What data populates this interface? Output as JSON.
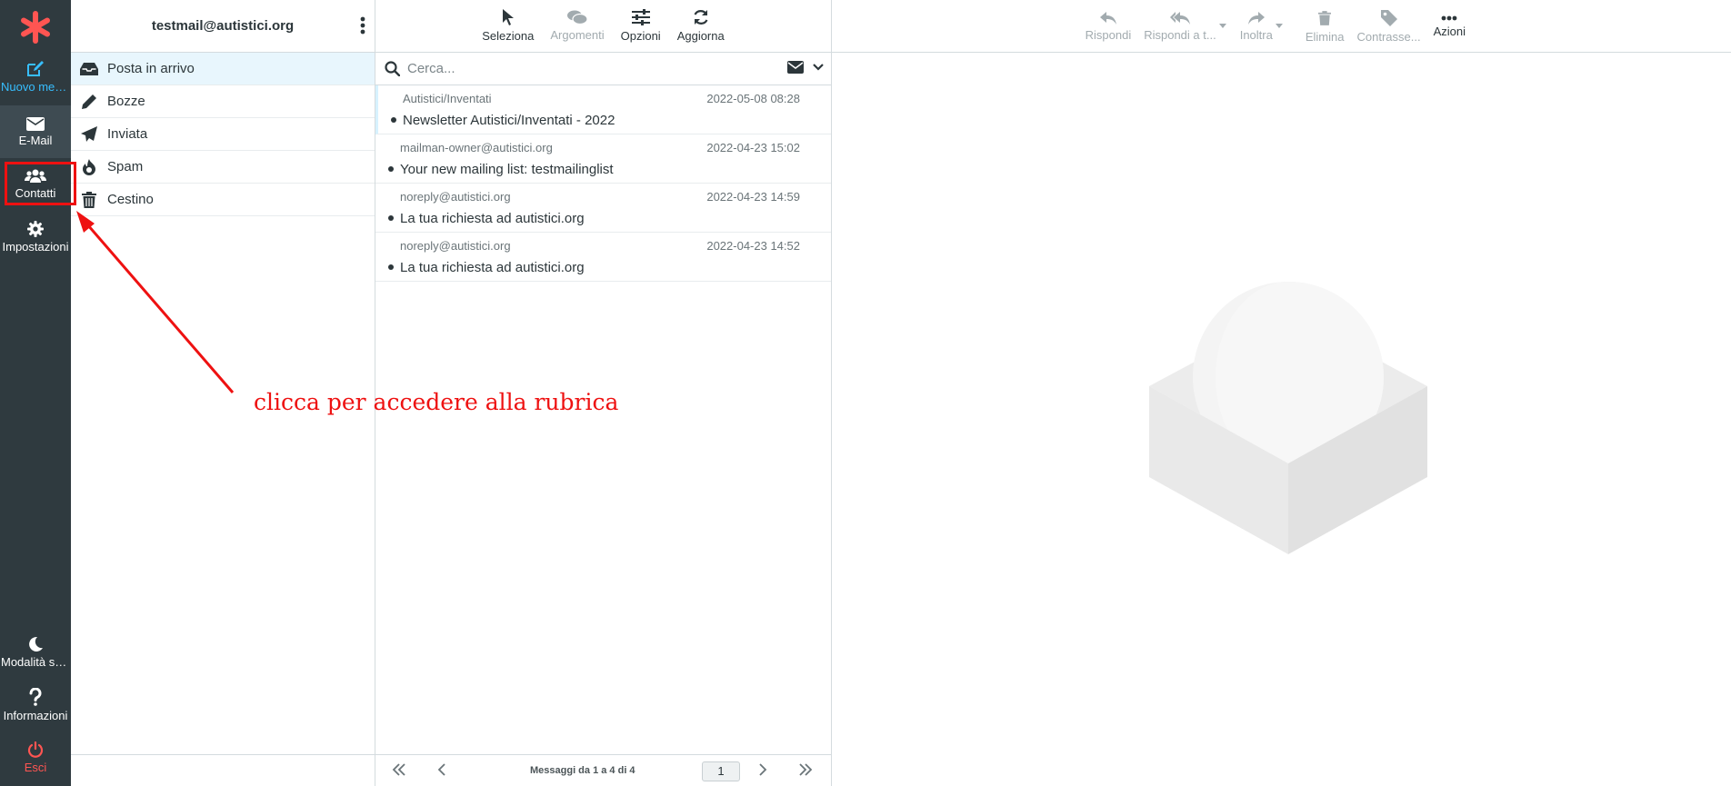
{
  "nav": {
    "compose_label": "Nuovo mes...",
    "mail_label": "E-Mail",
    "contacts_label": "Contatti",
    "settings_label": "Impostazioni",
    "darkmode_label": "Modalità sc...",
    "about_label": "Informazioni",
    "logout_label": "Esci"
  },
  "account": {
    "email": "testmail@autistici.org"
  },
  "folders": [
    {
      "label": "Posta in arrivo",
      "icon": "inbox-icon"
    },
    {
      "label": "Bozze",
      "icon": "pencil-icon"
    },
    {
      "label": "Inviata",
      "icon": "paper-plane-icon"
    },
    {
      "label": "Spam",
      "icon": "fire-icon"
    },
    {
      "label": "Cestino",
      "icon": "trash-icon"
    }
  ],
  "list_toolbar": {
    "select": "Seleziona",
    "threads": "Argomenti",
    "options": "Opzioni",
    "refresh": "Aggiorna"
  },
  "search": {
    "placeholder": "Cerca..."
  },
  "messages": [
    {
      "from": "Autistici/Inventati",
      "date": "2022-05-08 08:28",
      "subject": "Newsletter Autistici/Inventati - 2022"
    },
    {
      "from": "mailman-owner@autistici.org",
      "date": "2022-04-23 15:02",
      "subject": "Your new mailing list: testmailinglist"
    },
    {
      "from": "noreply@autistici.org",
      "date": "2022-04-23 14:59",
      "subject": "La tua richiesta ad autistici.org"
    },
    {
      "from": "noreply@autistici.org",
      "date": "2022-04-23 14:52",
      "subject": "La tua richiesta ad autistici.org"
    }
  ],
  "pager": {
    "count": "Messaggi da 1 a 4 di 4",
    "page": "1"
  },
  "content_toolbar": {
    "reply": "Rispondi",
    "reply_all": "Rispondi a t...",
    "forward": "Inoltra",
    "delete": "Elimina",
    "flag": "Contrasse...",
    "actions": "Azioni"
  },
  "annotation": {
    "text": "clicca per accedere alla rubrica"
  },
  "colors": {
    "accent": "#37beff",
    "nav_bg": "#2f3a3f",
    "logo": "#ff5552",
    "annotation": "#ee1111"
  }
}
